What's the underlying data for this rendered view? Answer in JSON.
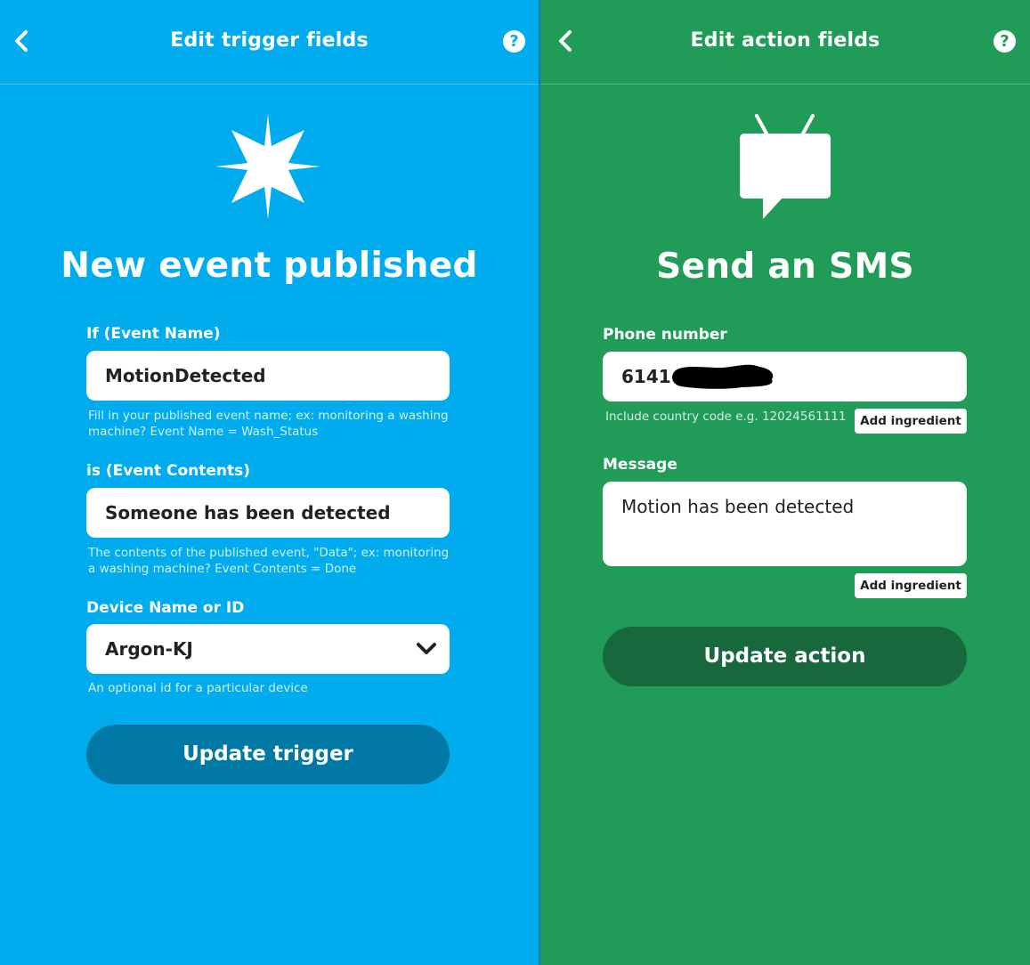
{
  "trigger_panel": {
    "header": {
      "title": "Edit trigger fields",
      "help_label": "?"
    },
    "service": {
      "icon": "particle-star-icon",
      "heading": "New event published"
    },
    "fields": [
      {
        "label": "If (Event Name)",
        "value": "MotionDetected",
        "help": "Fill in your published event name; ex: monitoring a washing machine? Event Name = Wash_Status"
      },
      {
        "label": "is (Event Contents)",
        "value": "Someone has been detected",
        "help": "The contents of the published event, \"Data\"; ex: monitoring a washing machine? Event Contents = Done"
      },
      {
        "label": "Device Name or ID",
        "value": "Argon-KJ",
        "help": "An optional id for a particular device"
      }
    ],
    "submit_label": "Update trigger",
    "colors": {
      "background": "#00aced",
      "button": "#0078a6"
    }
  },
  "action_panel": {
    "header": {
      "title": "Edit action fields",
      "help_label": "?"
    },
    "service": {
      "icon": "sms-tv-icon",
      "heading": "Send an SMS"
    },
    "fields": [
      {
        "label": "Phone number",
        "value": "6141",
        "help": "Include country code e.g. 12024561111",
        "ingredient_label": "Add ingredient"
      },
      {
        "label": "Message",
        "value": "Motion has been detected",
        "ingredient_label": "Add ingredient"
      }
    ],
    "submit_label": "Update action",
    "colors": {
      "background": "#209b58",
      "button": "#17683c"
    }
  }
}
